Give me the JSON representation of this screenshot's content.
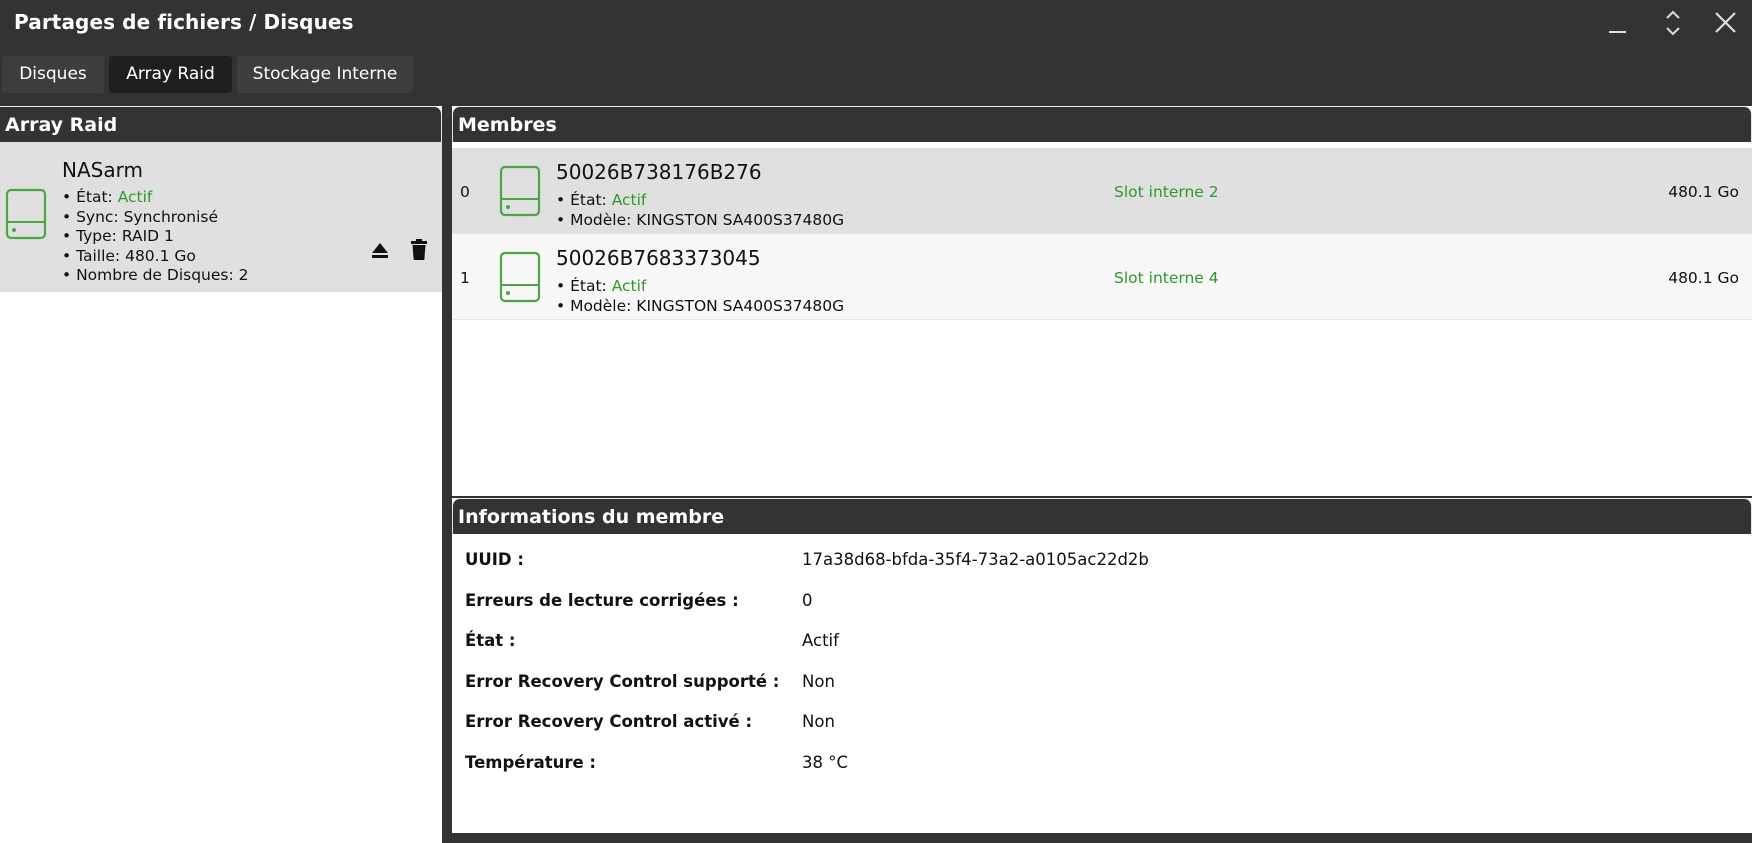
{
  "window": {
    "title": "Partages de fichiers / Disques"
  },
  "icons": {
    "minimize": "minimize-icon",
    "maximize": "chevrons-up-down-icon",
    "close": "close-icon",
    "disk": "hard-drive-icon",
    "eject": "eject-icon",
    "delete": "trash-icon"
  },
  "colors": {
    "accent_green": "#2e9a28",
    "header_bg": "#333333",
    "selected_row_bg": "#e0e0e0"
  },
  "tabs": [
    {
      "label": "Disques"
    },
    {
      "label": "Array Raid"
    },
    {
      "label": "Stockage Interne"
    }
  ],
  "active_tab": "Array Raid",
  "array_panel": {
    "header": "Array Raid",
    "array": {
      "name": "NASarm",
      "state_label": "État:",
      "state_value": "Actif",
      "sync": "Sync: Synchronisé",
      "type": "Type: RAID 1",
      "size": "Taille: 480.1 Go",
      "disk_count": "Nombre de Disques: 2"
    }
  },
  "members_panel": {
    "header": "Membres",
    "members": [
      {
        "index": "0",
        "serial": "50026B738176B276",
        "state_label": "État:",
        "state_value": "Actif",
        "model": "Modèle: KINGSTON SA400S37480G",
        "slot": "Slot interne 2",
        "size": "480.1 Go"
      },
      {
        "index": "1",
        "serial": "50026B7683373045",
        "state_label": "État:",
        "state_value": "Actif",
        "model": "Modèle: KINGSTON SA400S37480G",
        "slot": "Slot interne 4",
        "size": "480.1 Go"
      }
    ]
  },
  "info_panel": {
    "header": "Informations du membre",
    "rows": [
      {
        "label": "UUID :",
        "value": "17a38d68-bfda-35f4-73a2-a0105ac22d2b"
      },
      {
        "label": "Erreurs de lecture corrigées :",
        "value": "0"
      },
      {
        "label": "État :",
        "value": "Actif"
      },
      {
        "label": "Error Recovery Control supporté :",
        "value": "Non"
      },
      {
        "label": "Error Recovery Control activé :",
        "value": "Non"
      },
      {
        "label": "Température :",
        "value": "38 °C"
      }
    ]
  }
}
